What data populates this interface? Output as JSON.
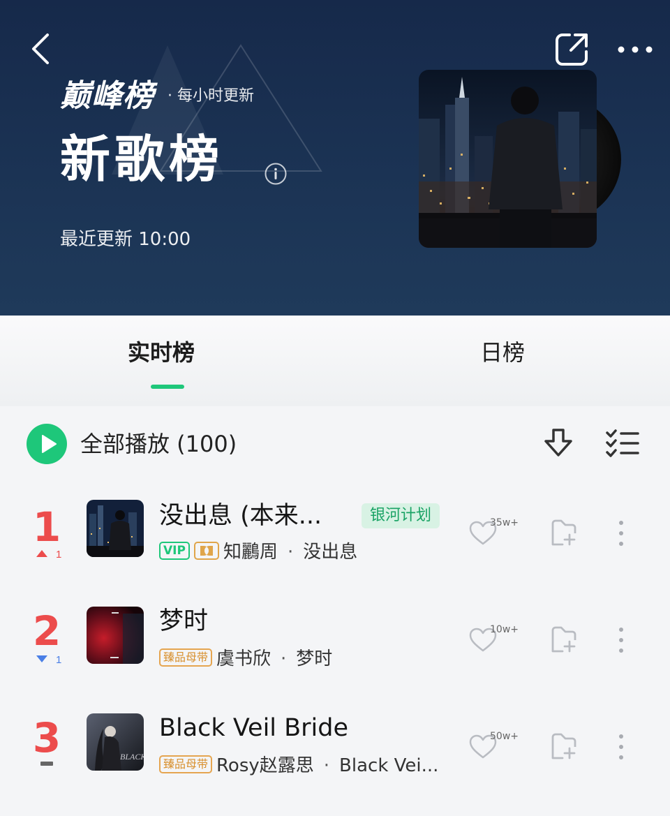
{
  "header": {
    "brand": "巅峰榜",
    "subtitle": "· 每小时更新",
    "title": "新歌榜",
    "last_update": "最近更新 10:00"
  },
  "icons": {
    "back": "chevron-left-icon",
    "share": "share-icon",
    "more": "more-horizontal-icon",
    "info": "info-icon",
    "play": "play-icon",
    "download": "download-icon",
    "multiselect": "checklist-icon",
    "like": "heart-icon",
    "add": "add-to-playlist-icon",
    "row_more": "more-vertical-icon"
  },
  "tabs": [
    {
      "label": "实时榜",
      "active": true
    },
    {
      "label": "日榜",
      "active": false
    }
  ],
  "playbar": {
    "label": "全部播放 (100)"
  },
  "colors": {
    "accent": "#1ec77a",
    "rank": "#ec4c4c",
    "trend_up": "#ec4c4c",
    "trend_down": "#4a7fe6",
    "header_bg": "#1b3354"
  },
  "songs": [
    {
      "rank": "1",
      "trend": "up",
      "trend_value": "1",
      "title": "没出息 (本来...",
      "tag": "银河计划",
      "badges": [
        "VIP",
        "dolby"
      ],
      "badge_vip": "VIP",
      "artist": "知鸝周",
      "album": "没出息",
      "likes": "35w+"
    },
    {
      "rank": "2",
      "trend": "down",
      "trend_value": "1",
      "title": "梦时",
      "badges": [
        "臻品母带"
      ],
      "badge_master": "臻品母带",
      "artist": "虞书欣",
      "album": "梦时",
      "likes": "10w+"
    },
    {
      "rank": "3",
      "trend": "same",
      "trend_value": "",
      "title": "Black Veil Bride",
      "badges": [
        "臻品母带"
      ],
      "badge_master": "臻品母带",
      "artist": "Rosy赵露思",
      "album": "Black Vei...",
      "likes": "50w+"
    }
  ]
}
